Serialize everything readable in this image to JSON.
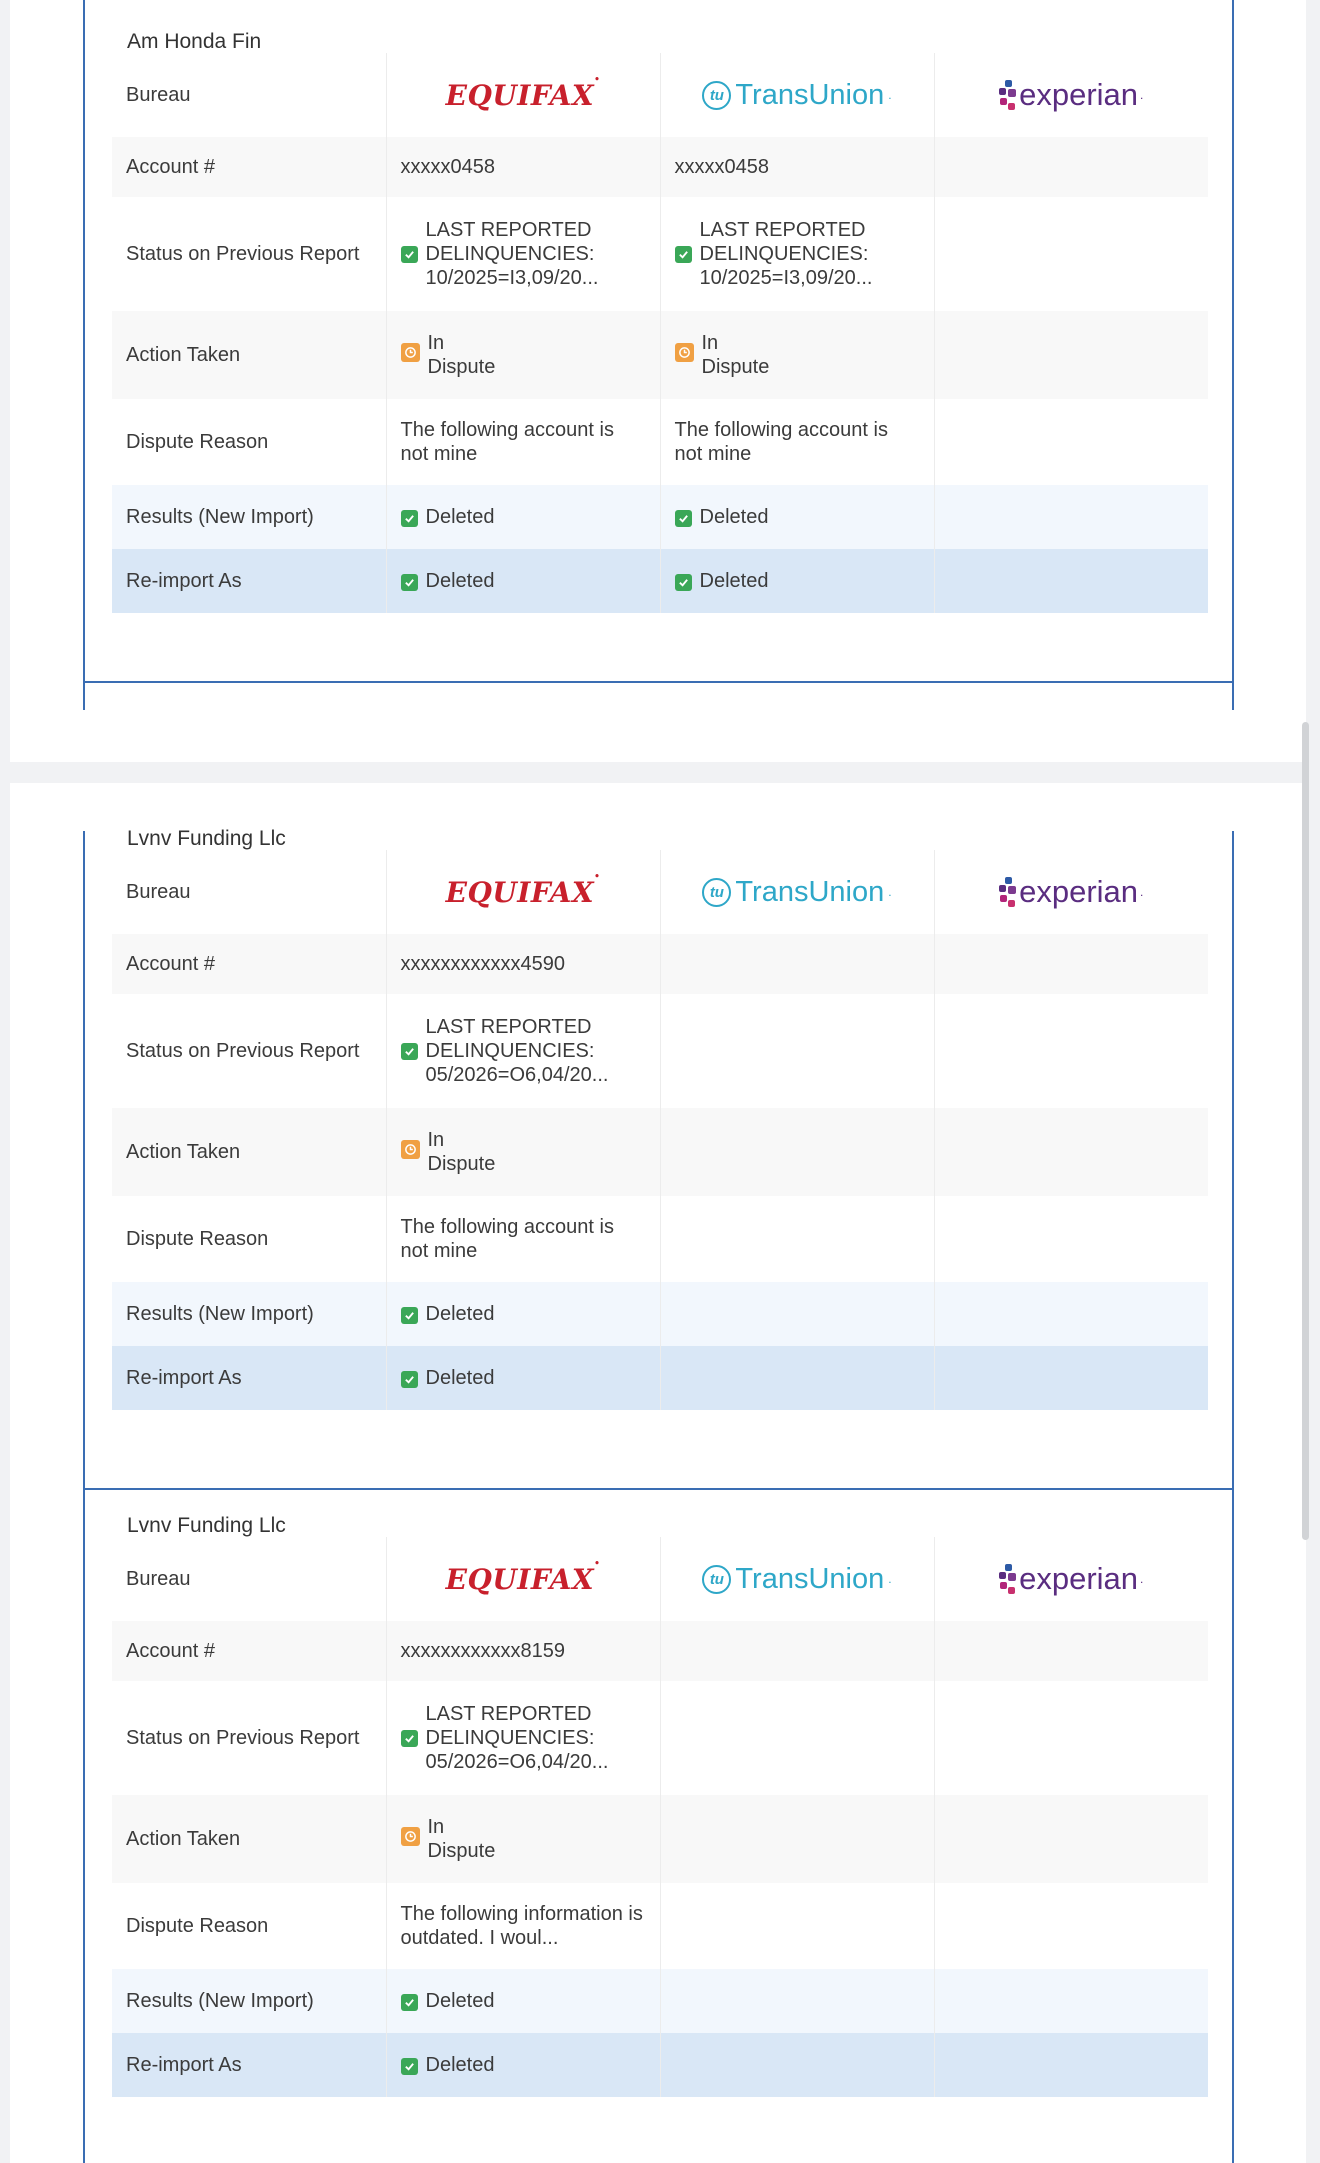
{
  "bureaus": {
    "equifax": {
      "label": "EQUIFAX",
      "color": "#c8202c"
    },
    "transunion": {
      "label": "TransUnion",
      "color": "#2ea7c8"
    },
    "experian": {
      "label": "experian",
      "color": "#5a2d80"
    }
  },
  "row_labels": {
    "bureau": "Bureau",
    "account": "Account #",
    "status": "Status on Previous Report",
    "action": "Action Taken",
    "reason": "Dispute Reason",
    "results": "Results (New Import)",
    "reimport": "Re-import As"
  },
  "sections": [
    {
      "creditor": "Am Honda Fin",
      "equifax": {
        "account": "xxxxx0458",
        "status": "LAST REPORTED DELINQUENCIES: 10/2025=I3,09/20...",
        "action": "In Dispute",
        "reason": "The following account is not mine",
        "results": "Deleted",
        "reimport": "Deleted"
      },
      "transunion": {
        "account": "xxxxx0458",
        "status": "LAST REPORTED DELINQUENCIES: 10/2025=I3,09/20...",
        "action": "In Dispute",
        "reason": "The following account is not mine",
        "results": "Deleted",
        "reimport": "Deleted"
      }
    },
    {
      "creditor": "Lvnv Funding Llc",
      "equifax": {
        "account": "xxxxxxxxxxxx4590",
        "status": "LAST REPORTED DELINQUENCIES: 05/2026=O6,04/20...",
        "action": "In Dispute",
        "reason": "The following account is not mine",
        "results": "Deleted",
        "reimport": "Deleted"
      }
    },
    {
      "creditor": "Lvnv Funding Llc",
      "equifax": {
        "account": "xxxxxxxxxxxx8159",
        "status": "LAST REPORTED DELINQUENCIES: 05/2026=O6,04/20...",
        "action": "In Dispute",
        "reason": "The following information is outdated. I woul...",
        "results": "Deleted",
        "reimport": "Deleted"
      }
    }
  ],
  "colors": {
    "frame": "#3a6db3",
    "check": "#3aa757",
    "clock": "#f0a043",
    "reimport_row": "#d9e7f6",
    "results_row": "#f2f7fd"
  }
}
